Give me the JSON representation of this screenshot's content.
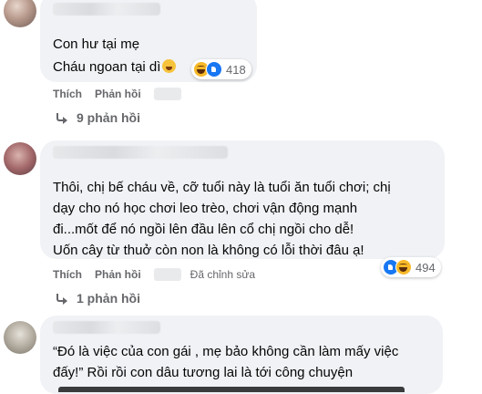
{
  "comments": [
    {
      "lines": [
        "Con hư tại mẹ",
        "Cháu ngoan tại dì"
      ],
      "reaction_count": "418",
      "actions": {
        "like": "Thích",
        "reply": "Phản hồi"
      },
      "replies_label": "9 phản hồi"
    },
    {
      "lines": [
        "Thôi, chị bế cháu về, cỡ tuổi này là tuổi ăn tuổi chơi; chị",
        "dạy cho nó học chơi leo trèo, chơi vận động mạnh",
        "đi...mốt để nó ngồi lên đầu lên cổ chị ngồi cho dễ!",
        "Uốn cây từ thuở còn non là không có lỗi thời đâu ạ!"
      ],
      "reaction_count": "494",
      "actions": {
        "like": "Thích",
        "reply": "Phản hồi",
        "edited": "Đã chỉnh sửa"
      },
      "replies_label": "1 phản hồi"
    },
    {
      "lines": [
        "“Đó là việc của con gái , mẹ bảo không cần làm mấy việc",
        "đấy!” Rồi rồi con dâu tương lai là tới công chuyện"
      ]
    }
  ],
  "icons": {
    "haha": "haha-reaction-icon",
    "like": "like-reaction-icon",
    "reply_arrow": "reply-arrow-icon"
  },
  "colors": {
    "bubble": "#f0f2f5",
    "muted_text": "#65676b",
    "like_blue": "#1877f2",
    "haha_yellow": "#f7b928"
  }
}
